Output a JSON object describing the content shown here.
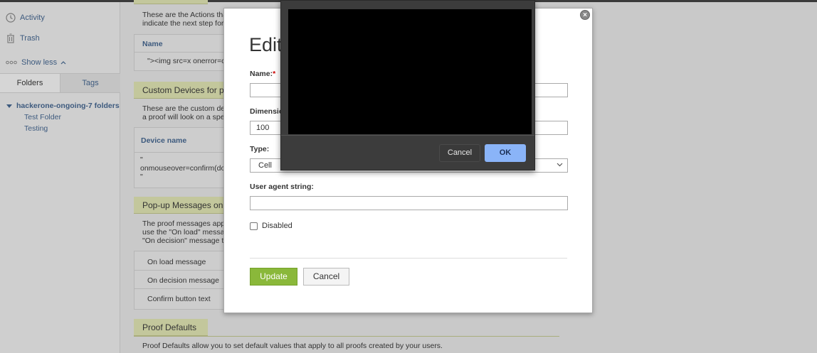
{
  "sidebar": {
    "activity_label": "Activity",
    "trash_label": "Trash",
    "show_less_label": "Show less",
    "tabs": [
      {
        "label": "Folders"
      },
      {
        "label": "Tags"
      }
    ],
    "folder_root": "hackerone-ongoing-7 folders",
    "subfolders": [
      {
        "label": "Test Folder"
      },
      {
        "label": "Testing"
      }
    ]
  },
  "background": {
    "actions_text_1": "These are the Actions tha",
    "actions_text_2": "indicate the next step for",
    "actions_table_header": "Name",
    "actions_row_value": "\"><img src=x onerror=co",
    "custom_devices_head": "Custom Devices for pro",
    "custom_devices_text_1": "These are the custom de",
    "custom_devices_text_2": "a proof will look on a spe",
    "device_table_header": "Device name",
    "device_row_line1": "\"",
    "device_row_line2": "onmouseover=confirm(do",
    "device_row_line3": "\"",
    "popup_head": "Pop-up Messages on p",
    "popup_text_1": "The proof messages app",
    "popup_text_2": "use the \"On load\" messag",
    "popup_text_3": "\"On decision\" message to",
    "popup_rows": [
      {
        "label": "On load message"
      },
      {
        "label": "On decision message"
      },
      {
        "label": "Confirm button text"
      }
    ],
    "defaults_head": "Proof Defaults",
    "defaults_text": "Proof Defaults allow you to set default values that apply to all proofs created by your users."
  },
  "modal": {
    "title": "Edit",
    "name_label": "Name:",
    "required_mark": "*",
    "name_value": "",
    "dimension_label": "Dimensio",
    "dimension_value": "100",
    "dimension_right_value": "",
    "type_label": "Type:",
    "type_value": "Cell",
    "user_agent_label": "User agent string:",
    "user_agent_value": "",
    "disabled_label": "Disabled",
    "update_label": "Update",
    "cancel_label": "Cancel",
    "close_glyph": "×"
  },
  "dialog": {
    "cancel_label": "Cancel",
    "ok_label": "OK"
  }
}
